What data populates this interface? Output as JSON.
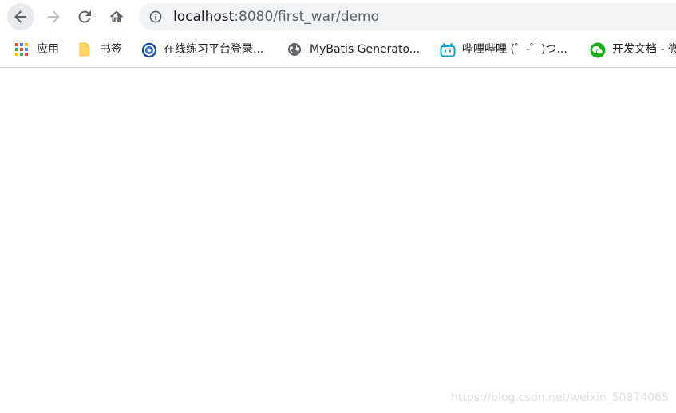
{
  "toolbar": {
    "url_host": "localhost",
    "url_path": ":8080/first_war/demo",
    "back_icon": "arrow-left-icon",
    "forward_icon": "arrow-right-icon",
    "reload_icon": "reload-icon",
    "home_icon": "home-icon",
    "info_icon": "info-icon"
  },
  "bookmarks": [
    {
      "label": "应用",
      "icon": "apps-grid-icon"
    },
    {
      "label": "书签",
      "icon": "folder-icon"
    },
    {
      "label": "在线练习平台登录...",
      "icon": "university-seal-icon"
    },
    {
      "label": "MyBatis Generato...",
      "icon": "globe-icon"
    },
    {
      "label": "哔哩哔哩 (゜-゜)つ...",
      "icon": "bilibili-tv-icon"
    },
    {
      "label": "开发文档 - 微",
      "icon": "wechat-icon"
    }
  ],
  "watermark": "https://blog.csdn.net/weixin_50874065",
  "colors": {
    "toolbar_bg": "#ffffff",
    "omnibox_bg": "#f1f3f4",
    "back_btn_bg": "#e8eaed",
    "text": "#202124",
    "muted_text": "#5f6368",
    "bilibili_blue": "#00a1d6",
    "wechat_green": "#1aad19"
  }
}
